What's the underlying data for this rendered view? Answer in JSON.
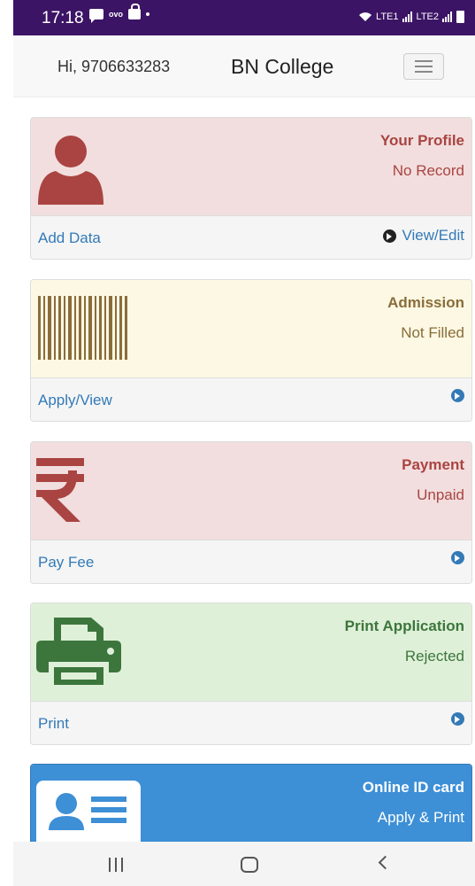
{
  "status_bar": {
    "time": "17:18",
    "ovo": "ovo",
    "lte1": "LTE1",
    "lte2": "LTE2",
    "bg_color": "#3c1466"
  },
  "navbar": {
    "greeting": "Hi, 9706633283",
    "brand": "BN College"
  },
  "cards": [
    {
      "title": "Your Profile",
      "status": "No Record",
      "link": "Add Data",
      "right_link": "View/Edit",
      "icon": "user-icon",
      "style": "danger"
    },
    {
      "title": "Admission",
      "status": "Not Filled",
      "link": "Apply/View",
      "icon": "barcode-icon",
      "style": "warning"
    },
    {
      "title": "Payment",
      "status": "Unpaid",
      "link": "Pay Fee",
      "icon": "rupee-icon",
      "style": "danger"
    },
    {
      "title": "Print Application",
      "status": "Rejected",
      "link": "Print",
      "icon": "printer-icon",
      "style": "success"
    },
    {
      "title": "Online ID card",
      "status": "Apply & Print",
      "icon": "id-card-icon",
      "style": "primary"
    }
  ],
  "colors": {
    "danger_bg": "#f2dede",
    "danger_text": "#a94442",
    "warning_bg": "#fcf8e3",
    "warning_text": "#8a6d3b",
    "success_bg": "#dff0d8",
    "success_text": "#3c763d",
    "primary_bg": "#3d8fd6",
    "link": "#337ab7"
  }
}
